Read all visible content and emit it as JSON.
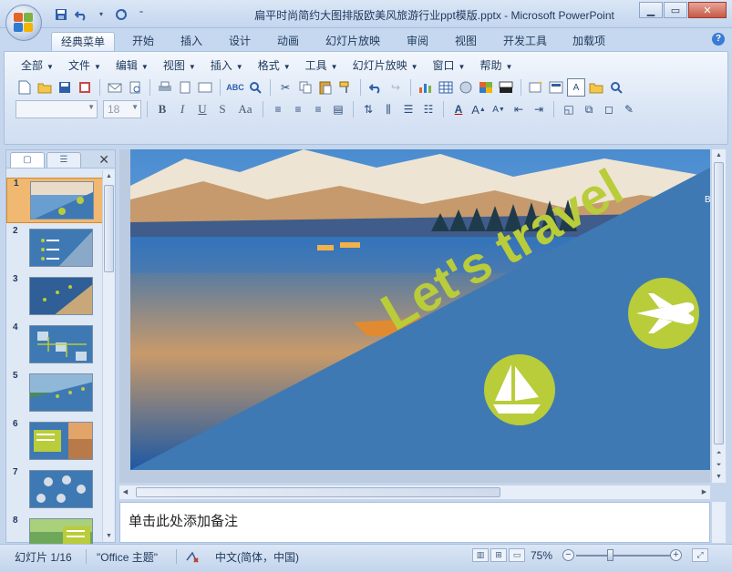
{
  "window": {
    "title": "扁平时尚简约大图排版欧美风旅游行业ppt模版.pptx - Microsoft PowerPoint",
    "controls": [
      "minimize-icon",
      "maximize-icon",
      "close-icon"
    ]
  },
  "ribbon_tabs": [
    {
      "label": "经典菜单",
      "active": true
    },
    {
      "label": "开始"
    },
    {
      "label": "插入"
    },
    {
      "label": "设计"
    },
    {
      "label": "动画"
    },
    {
      "label": "幻灯片放映"
    },
    {
      "label": "审阅"
    },
    {
      "label": "视图"
    },
    {
      "label": "开发工具"
    },
    {
      "label": "加载项"
    }
  ],
  "classic_menus": [
    "全部",
    "文件",
    "编辑",
    "视图",
    "插入",
    "格式",
    "工具",
    "幻灯片放映",
    "窗口",
    "帮助"
  ],
  "toolbar": {
    "font_name": "",
    "font_size": "18",
    "format_buttons": [
      "B",
      "I",
      "U",
      "S",
      "Aa"
    ]
  },
  "slides_pane": {
    "slides": [
      {
        "num": "1",
        "selected": true
      },
      {
        "num": "2"
      },
      {
        "num": "3"
      },
      {
        "num": "4"
      },
      {
        "num": "5"
      },
      {
        "num": "6"
      },
      {
        "num": "7"
      },
      {
        "num": "8"
      }
    ]
  },
  "slide": {
    "headline": "Let's travel",
    "accent_color": "#b9cc3a",
    "panel_color": "#3e79b4"
  },
  "notes": {
    "placeholder": "单击此处添加备注"
  },
  "status": {
    "slide_info": "幻灯片 1/16",
    "theme": "\"Office 主题\"",
    "language": "中文(简体，中国)",
    "zoom": "75%"
  }
}
